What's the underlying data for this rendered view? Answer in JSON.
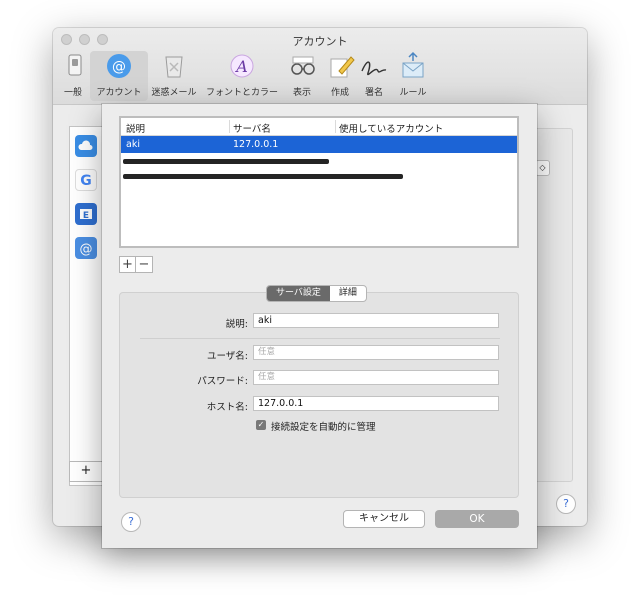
{
  "window": {
    "title": "アカウント"
  },
  "toolbar": [
    {
      "id": "general",
      "label": "一般",
      "icon": "general-switch-icon"
    },
    {
      "id": "accounts",
      "label": "アカウント",
      "icon": "at-sign-icon",
      "selected": true
    },
    {
      "id": "junk",
      "label": "迷惑メール",
      "icon": "junk-mail-icon"
    },
    {
      "id": "fonts",
      "label": "フォントとカラー",
      "icon": "fonts-colors-icon"
    },
    {
      "id": "viewing",
      "label": "表示",
      "icon": "glasses-icon"
    },
    {
      "id": "composing",
      "label": "作成",
      "icon": "pencil-icon"
    },
    {
      "id": "signatures",
      "label": "署名",
      "icon": "signature-icon"
    },
    {
      "id": "rules",
      "label": "ルール",
      "icon": "rules-icon"
    }
  ],
  "sidebar_accounts": [
    {
      "icon": "icloud-icon",
      "color": "#3a8ee6"
    },
    {
      "icon": "google-icon",
      "color": "#ffffff"
    },
    {
      "icon": "exchange-icon",
      "color": "#2f6fd0"
    },
    {
      "icon": "at-account-icon",
      "color": "#4b8fe3"
    }
  ],
  "sidebar_add_label": "+",
  "sheet": {
    "table": {
      "headers": [
        "説明",
        "サーバ名",
        "使用しているアカウント"
      ],
      "rows": [
        {
          "description": "aki",
          "server": "127.0.0.1",
          "account": ""
        }
      ]
    },
    "add_label": "+",
    "remove_label": "−",
    "segments": {
      "server_settings": "サーバ設定",
      "advanced": "詳細"
    },
    "form": {
      "description_label": "説明:",
      "description_value": "aki",
      "username_label": "ユーザ名:",
      "username_placeholder": "任意",
      "password_label": "パスワード:",
      "password_placeholder": "任意",
      "host_label": "ホスト名:",
      "host_value": "127.0.0.1",
      "auto_manage_label": "接続設定を自動的に管理",
      "auto_manage_checked": true
    },
    "help_label": "?",
    "cancel_label": "キャンセル",
    "ok_label": "OK"
  },
  "background": {
    "popup_arrow": "◇",
    "help_label": "?"
  },
  "colors": {
    "selection": "#1c64d6",
    "ok_button": "#a9a9a9",
    "accent": "#3b6fd6"
  }
}
